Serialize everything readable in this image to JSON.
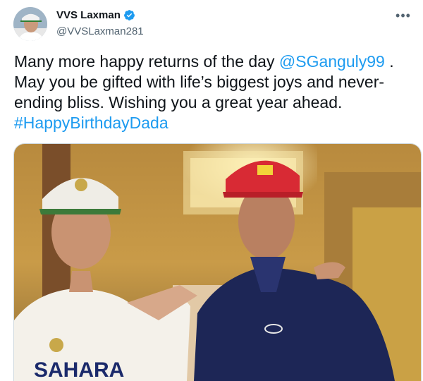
{
  "tweet": {
    "author_name": "VVS Laxman",
    "handle": "@VVSLaxman281",
    "verified": true,
    "text_parts": {
      "line1": "Many more happy returns of the day ",
      "mention": "@SGanguly99",
      "after_mention": " .",
      "line2": "May you be gifted with life’s biggest joys and never-",
      "line3": "ending bliss. Wishing you a great year ahead.",
      "hashtag": "#HappyBirthdayDada"
    },
    "more_icon": "more-horizontal-icon",
    "media": {
      "jersey_text": "SAHARA",
      "description_icon": "photo"
    }
  },
  "colors": {
    "link": "#1d9bf0",
    "verified": "#1d9bf0",
    "text": "#0f1419",
    "secondary": "#536471"
  }
}
